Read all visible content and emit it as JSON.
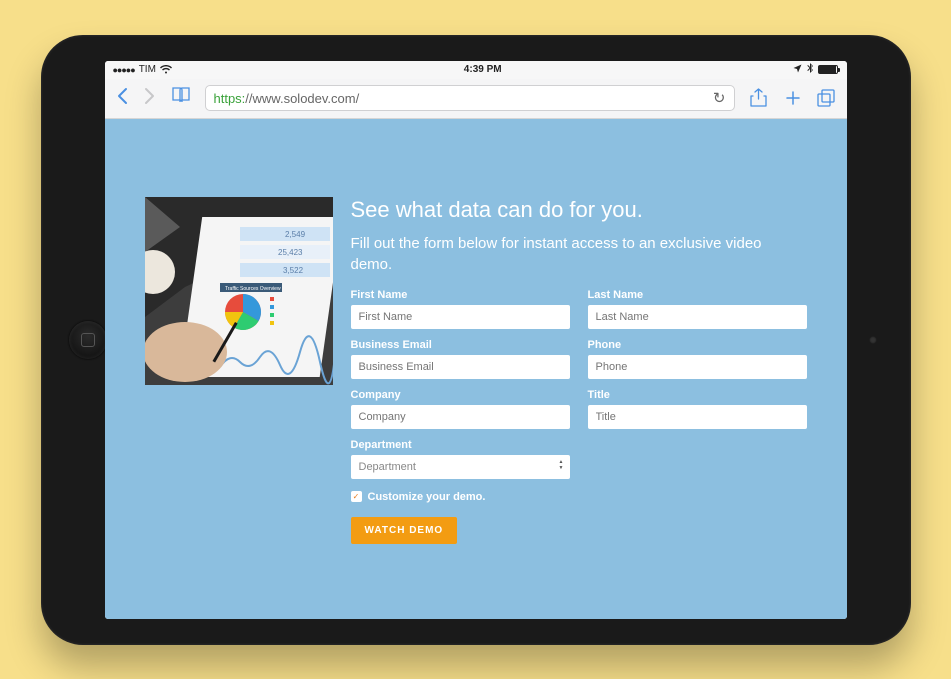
{
  "status": {
    "carrier": "TIM",
    "time": "4:39 PM"
  },
  "browser": {
    "url_scheme": "https:",
    "url_rest": "//www.solodev.com/"
  },
  "page": {
    "headline": "See what data can do for you.",
    "sub": "Fill out the form below for instant access to an exclusive video demo.",
    "labels": {
      "first_name": "First Name",
      "last_name": "Last Name",
      "email": "Business Email",
      "phone": "Phone",
      "company": "Company",
      "title": "Title",
      "department": "Department"
    },
    "placeholders": {
      "first_name": "First Name",
      "last_name": "Last Name",
      "email": "Business Email",
      "phone": "Phone",
      "company": "Company",
      "title": "Title",
      "department": "Department"
    },
    "checkbox_label": "Customize your demo.",
    "button_label": "WATCH DEMO"
  }
}
